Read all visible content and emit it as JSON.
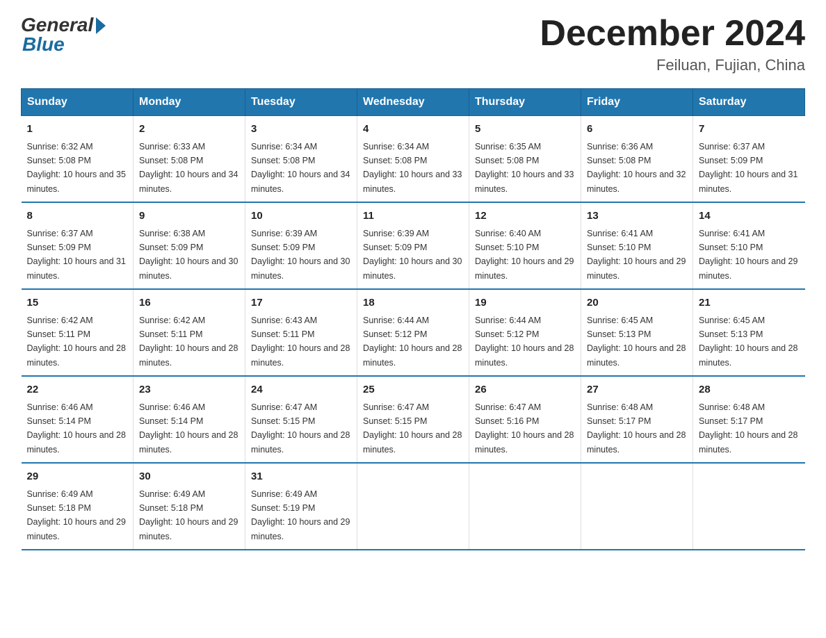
{
  "header": {
    "logo_general": "General",
    "logo_blue": "Blue",
    "month_title": "December 2024",
    "location": "Feiluan, Fujian, China"
  },
  "days_of_week": [
    "Sunday",
    "Monday",
    "Tuesday",
    "Wednesday",
    "Thursday",
    "Friday",
    "Saturday"
  ],
  "weeks": [
    [
      {
        "day": "1",
        "sunrise": "6:32 AM",
        "sunset": "5:08 PM",
        "daylight": "10 hours and 35 minutes."
      },
      {
        "day": "2",
        "sunrise": "6:33 AM",
        "sunset": "5:08 PM",
        "daylight": "10 hours and 34 minutes."
      },
      {
        "day": "3",
        "sunrise": "6:34 AM",
        "sunset": "5:08 PM",
        "daylight": "10 hours and 34 minutes."
      },
      {
        "day": "4",
        "sunrise": "6:34 AM",
        "sunset": "5:08 PM",
        "daylight": "10 hours and 33 minutes."
      },
      {
        "day": "5",
        "sunrise": "6:35 AM",
        "sunset": "5:08 PM",
        "daylight": "10 hours and 33 minutes."
      },
      {
        "day": "6",
        "sunrise": "6:36 AM",
        "sunset": "5:08 PM",
        "daylight": "10 hours and 32 minutes."
      },
      {
        "day": "7",
        "sunrise": "6:37 AM",
        "sunset": "5:09 PM",
        "daylight": "10 hours and 31 minutes."
      }
    ],
    [
      {
        "day": "8",
        "sunrise": "6:37 AM",
        "sunset": "5:09 PM",
        "daylight": "10 hours and 31 minutes."
      },
      {
        "day": "9",
        "sunrise": "6:38 AM",
        "sunset": "5:09 PM",
        "daylight": "10 hours and 30 minutes."
      },
      {
        "day": "10",
        "sunrise": "6:39 AM",
        "sunset": "5:09 PM",
        "daylight": "10 hours and 30 minutes."
      },
      {
        "day": "11",
        "sunrise": "6:39 AM",
        "sunset": "5:09 PM",
        "daylight": "10 hours and 30 minutes."
      },
      {
        "day": "12",
        "sunrise": "6:40 AM",
        "sunset": "5:10 PM",
        "daylight": "10 hours and 29 minutes."
      },
      {
        "day": "13",
        "sunrise": "6:41 AM",
        "sunset": "5:10 PM",
        "daylight": "10 hours and 29 minutes."
      },
      {
        "day": "14",
        "sunrise": "6:41 AM",
        "sunset": "5:10 PM",
        "daylight": "10 hours and 29 minutes."
      }
    ],
    [
      {
        "day": "15",
        "sunrise": "6:42 AM",
        "sunset": "5:11 PM",
        "daylight": "10 hours and 28 minutes."
      },
      {
        "day": "16",
        "sunrise": "6:42 AM",
        "sunset": "5:11 PM",
        "daylight": "10 hours and 28 minutes."
      },
      {
        "day": "17",
        "sunrise": "6:43 AM",
        "sunset": "5:11 PM",
        "daylight": "10 hours and 28 minutes."
      },
      {
        "day": "18",
        "sunrise": "6:44 AM",
        "sunset": "5:12 PM",
        "daylight": "10 hours and 28 minutes."
      },
      {
        "day": "19",
        "sunrise": "6:44 AM",
        "sunset": "5:12 PM",
        "daylight": "10 hours and 28 minutes."
      },
      {
        "day": "20",
        "sunrise": "6:45 AM",
        "sunset": "5:13 PM",
        "daylight": "10 hours and 28 minutes."
      },
      {
        "day": "21",
        "sunrise": "6:45 AM",
        "sunset": "5:13 PM",
        "daylight": "10 hours and 28 minutes."
      }
    ],
    [
      {
        "day": "22",
        "sunrise": "6:46 AM",
        "sunset": "5:14 PM",
        "daylight": "10 hours and 28 minutes."
      },
      {
        "day": "23",
        "sunrise": "6:46 AM",
        "sunset": "5:14 PM",
        "daylight": "10 hours and 28 minutes."
      },
      {
        "day": "24",
        "sunrise": "6:47 AM",
        "sunset": "5:15 PM",
        "daylight": "10 hours and 28 minutes."
      },
      {
        "day": "25",
        "sunrise": "6:47 AM",
        "sunset": "5:15 PM",
        "daylight": "10 hours and 28 minutes."
      },
      {
        "day": "26",
        "sunrise": "6:47 AM",
        "sunset": "5:16 PM",
        "daylight": "10 hours and 28 minutes."
      },
      {
        "day": "27",
        "sunrise": "6:48 AM",
        "sunset": "5:17 PM",
        "daylight": "10 hours and 28 minutes."
      },
      {
        "day": "28",
        "sunrise": "6:48 AM",
        "sunset": "5:17 PM",
        "daylight": "10 hours and 28 minutes."
      }
    ],
    [
      {
        "day": "29",
        "sunrise": "6:49 AM",
        "sunset": "5:18 PM",
        "daylight": "10 hours and 29 minutes."
      },
      {
        "day": "30",
        "sunrise": "6:49 AM",
        "sunset": "5:18 PM",
        "daylight": "10 hours and 29 minutes."
      },
      {
        "day": "31",
        "sunrise": "6:49 AM",
        "sunset": "5:19 PM",
        "daylight": "10 hours and 29 minutes."
      },
      null,
      null,
      null,
      null
    ]
  ]
}
